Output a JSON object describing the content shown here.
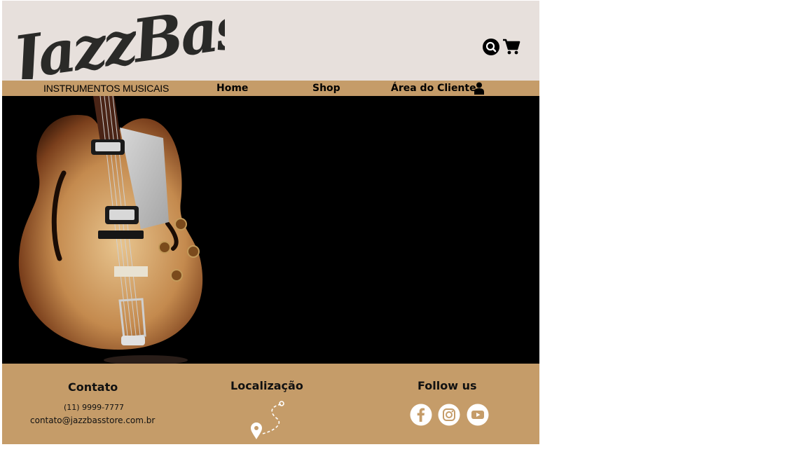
{
  "brand": {
    "logo_text": "JazzBass"
  },
  "header": {
    "icons": [
      "search-icon",
      "cart-icon"
    ]
  },
  "nav": {
    "items": [
      {
        "label": "INSTRUMENTOS MUSICAIS"
      },
      {
        "label": "Home"
      },
      {
        "label": "Shop"
      },
      {
        "label": "Área do Cliente",
        "icon": "user-icon"
      }
    ]
  },
  "hero": {
    "image": "hollow-body-bass-guitar"
  },
  "footer": {
    "contact": {
      "title": "Contato",
      "phone": "(11) 9999-7777",
      "email": "contato@jazzbasstore.com.br"
    },
    "location": {
      "title": "Localização",
      "icon": "map-route-icon"
    },
    "social": {
      "title": "Follow us",
      "icons": [
        "facebook-icon",
        "instagram-icon",
        "youtube-icon"
      ]
    }
  },
  "colors": {
    "header_bg": "#e7e0dc",
    "accent": "#c59c69",
    "hero_bg": "#000000"
  }
}
